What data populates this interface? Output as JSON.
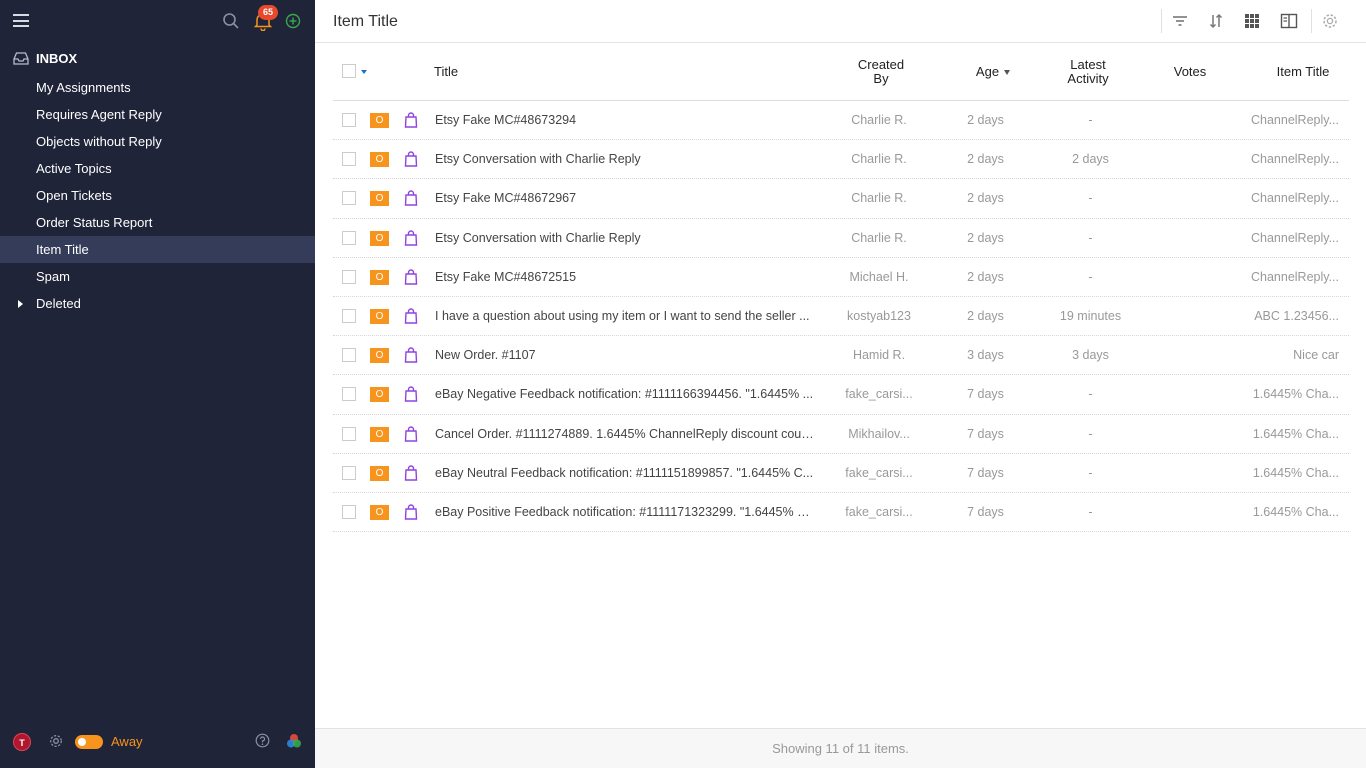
{
  "sidebar": {
    "notification_count": "65",
    "inbox_label": "INBOX",
    "items": [
      {
        "label": "My Assignments"
      },
      {
        "label": "Requires Agent Reply"
      },
      {
        "label": "Objects without Reply"
      },
      {
        "label": "Active Topics"
      },
      {
        "label": "Open Tickets"
      },
      {
        "label": "Order Status Report"
      },
      {
        "label": "Item Title"
      },
      {
        "label": "Spam"
      },
      {
        "label": "Deleted"
      }
    ],
    "active_item": "Item Title",
    "user_initial": "T",
    "status_label": "Away"
  },
  "header": {
    "title": "Item Title"
  },
  "table": {
    "columns": {
      "title": "Title",
      "created_by_line1": "Created",
      "created_by_line2": "By",
      "age": "Age",
      "latest_activity_line1": "Latest",
      "latest_activity_line2": "Activity",
      "votes": "Votes",
      "item_title": "Item Title"
    },
    "rows": [
      {
        "tag": "O",
        "title": "Etsy Fake MC#48673294",
        "created_by": "Charlie R.",
        "age": "2 days",
        "latest_activity": "-",
        "votes": "",
        "item_title": "ChannelReply..."
      },
      {
        "tag": "O",
        "title": "Etsy Conversation with Charlie Reply",
        "created_by": "Charlie R.",
        "age": "2 days",
        "latest_activity": "2 days",
        "votes": "",
        "item_title": "ChannelReply..."
      },
      {
        "tag": "O",
        "title": "Etsy Fake MC#48672967",
        "created_by": "Charlie R.",
        "age": "2 days",
        "latest_activity": "-",
        "votes": "",
        "item_title": "ChannelReply..."
      },
      {
        "tag": "O",
        "title": "Etsy Conversation with Charlie Reply",
        "created_by": "Charlie R.",
        "age": "2 days",
        "latest_activity": "-",
        "votes": "",
        "item_title": "ChannelReply..."
      },
      {
        "tag": "O",
        "title": "Etsy Fake MC#48672515",
        "created_by": "Michael H.",
        "age": "2 days",
        "latest_activity": "-",
        "votes": "",
        "item_title": "ChannelReply..."
      },
      {
        "tag": "O",
        "title": "I have a question about using my item or I want to send the seller ...",
        "created_by": "kostyab123",
        "age": "2 days",
        "latest_activity": "19 minutes",
        "votes": "",
        "item_title": "ABC 1.23456..."
      },
      {
        "tag": "O",
        "title": "New Order. #1107",
        "created_by": "Hamid R.",
        "age": "3 days",
        "latest_activity": "3 days",
        "votes": "",
        "item_title": "Nice car"
      },
      {
        "tag": "O",
        "title": "eBay Negative Feedback notification: #1111166394456. \"1.6445% ...",
        "created_by": "fake_carsi...",
        "age": "7 days",
        "latest_activity": "-",
        "votes": "",
        "item_title": "1.6445% Cha..."
      },
      {
        "tag": "O",
        "title": "Cancel Order. #1111274889. 1.6445% ChannelReply discount coup...",
        "created_by": "Mikhailov...",
        "age": "7 days",
        "latest_activity": "-",
        "votes": "",
        "item_title": "1.6445% Cha..."
      },
      {
        "tag": "O",
        "title": "eBay Neutral Feedback notification: #1111151899857. \"1.6445% C...",
        "created_by": "fake_carsi...",
        "age": "7 days",
        "latest_activity": "-",
        "votes": "",
        "item_title": "1.6445% Cha..."
      },
      {
        "tag": "O",
        "title": "eBay Positive Feedback notification: #1111171323299. \"1.6445% C...",
        "created_by": "fake_carsi...",
        "age": "7 days",
        "latest_activity": "-",
        "votes": "",
        "item_title": "1.6445% Cha..."
      }
    ]
  },
  "footer": {
    "status": "Showing 11 of 11 items."
  },
  "colors": {
    "sidebar_bg": "#1f2438",
    "sidebar_active": "#353c59",
    "accent_orange": "#f7941d",
    "badge_red": "#e8492b",
    "bag_purple": "#8e44e0"
  },
  "icons": {
    "menu": "hamburger-icon",
    "search": "search-icon",
    "notifications": "bell-icon",
    "add": "plus-circle-icon",
    "inbox": "inbox-icon",
    "filter": "filter-icon",
    "sort": "sort-icon",
    "grid": "grid-icon",
    "columns": "columns-icon",
    "settings": "gear-icon",
    "help": "help-icon",
    "apps": "apps-color-icon",
    "row_type": "shopping-bag-icon"
  }
}
